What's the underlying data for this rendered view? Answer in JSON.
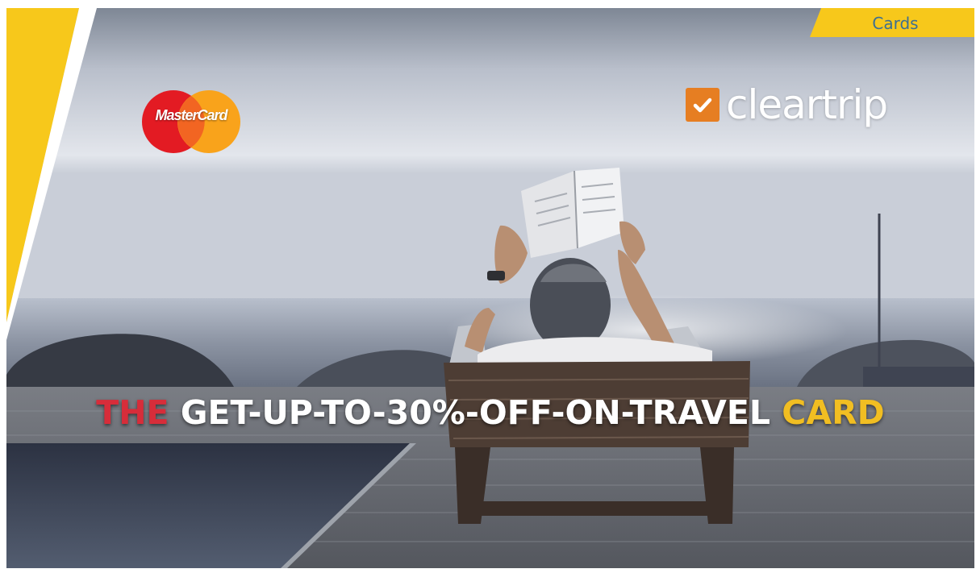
{
  "tab": {
    "label": "Cards"
  },
  "mastercard": {
    "text": "MasterCard"
  },
  "cleartrip": {
    "text": "cleartrip"
  },
  "headline": {
    "the": "THE",
    "middle": "GET-UP-TO-30%-OFF-ON-TRAVEL",
    "card": "CARD"
  },
  "colors": {
    "brand_yellow": "#f7c81b",
    "headline_red": "#d72d3a",
    "headline_yellow": "#f1be22",
    "cleartrip_orange": "#e67e22",
    "mastercard_red": "#e31b23",
    "mastercard_yellow": "#f9a31b",
    "tab_text": "#3d6f92"
  },
  "icons": [
    "mastercard-logo",
    "cleartrip-check-icon"
  ]
}
